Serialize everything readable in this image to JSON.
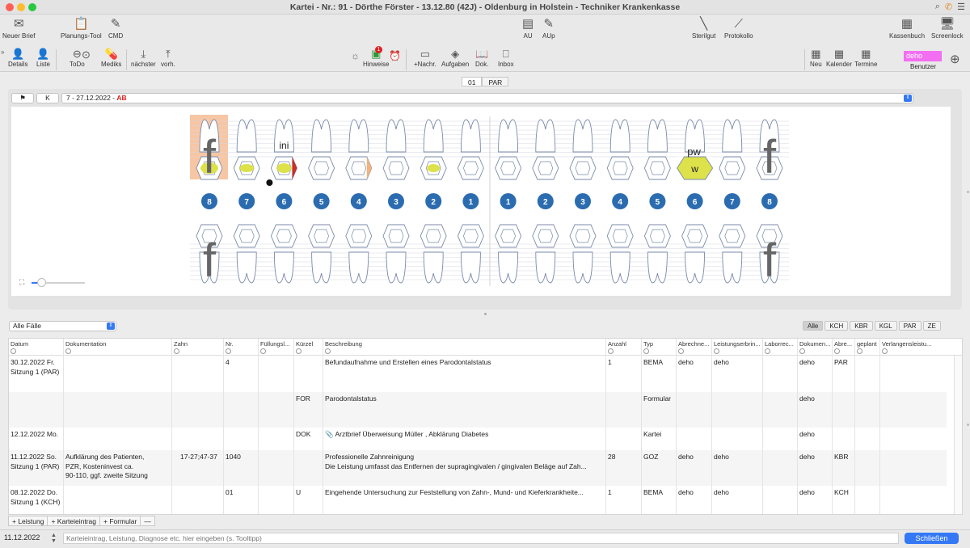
{
  "window": {
    "title": "Kartei - Nr.: 91 - Dörthe Förster - 13.12.80 (42J) - Oldenburg in Holstein - Techniker Krankenkasse"
  },
  "toolbar_top": [
    {
      "label": "Neuer Brief",
      "icon": "letter-icon"
    },
    {
      "label": "Planungs-Tool",
      "icon": "clipboard-icon"
    },
    {
      "label": "CMD",
      "icon": "edit-icon"
    },
    {
      "label": "AU",
      "icon": "document-icon"
    },
    {
      "label": "AUp",
      "icon": "document-edit-icon"
    },
    {
      "label": "Sterilgut",
      "icon": "instrument-icon"
    },
    {
      "label": "Protokollo",
      "icon": "instrument-icon"
    },
    {
      "label": "Kassenbuch",
      "icon": "register-icon"
    },
    {
      "label": "Screenlock",
      "icon": "monitor-lock-icon"
    }
  ],
  "toolbar_second": [
    {
      "label": "Details",
      "icon": "person-icon"
    },
    {
      "label": "Liste",
      "icon": "person-add-icon"
    },
    {
      "label": "ToDo",
      "icon": "arrow-back-icon"
    },
    {
      "label": "Mediks",
      "icon": "pills-icon"
    },
    {
      "label": "nächster",
      "icon": "next-icon"
    },
    {
      "label": "vorh.",
      "icon": "previous-icon"
    },
    {
      "label": "Hinweise",
      "icon": "alert-icon",
      "badge": "1"
    },
    {
      "label": "+Nachr.",
      "icon": "message-icon"
    },
    {
      "label": "Aufgaben",
      "icon": "tasks-icon"
    },
    {
      "label": "Dok.",
      "icon": "book-icon"
    },
    {
      "label": "Inbox",
      "icon": "inbox-icon"
    },
    {
      "label": "Neu",
      "icon": "calendar-add-icon"
    },
    {
      "label": "Kalender",
      "icon": "calendar-icon"
    },
    {
      "label": "Termine",
      "icon": "calendar-icon"
    },
    {
      "label": "Benutzer",
      "icon": "user-icon"
    }
  ],
  "user": {
    "name": "deho"
  },
  "segments": [
    {
      "label": "01",
      "active": true
    },
    {
      "label": "PAR",
      "active": false
    }
  ],
  "chart_header": {
    "flag_label": "",
    "k_label": "K",
    "period": "7 - 27.12.2022 - ",
    "period_code": "AB"
  },
  "teeth": {
    "upper_markers": {
      "f_left": "f",
      "f_right": "f",
      "ini": "ini",
      "pw": "pw",
      "w": "w"
    },
    "lower_markers": {
      "f_left": "f",
      "f_right": "f"
    },
    "numbers": [
      "8",
      "7",
      "6",
      "5",
      "4",
      "3",
      "2",
      "1",
      "1",
      "2",
      "3",
      "4",
      "5",
      "6",
      "7",
      "8"
    ]
  },
  "cases": {
    "selected": "Alle Fälle"
  },
  "filters": [
    {
      "label": "Alle",
      "active": true
    },
    {
      "label": "KCH",
      "active": false
    },
    {
      "label": "KBR",
      "active": false
    },
    {
      "label": "KGL",
      "active": false
    },
    {
      "label": "PAR",
      "active": false
    },
    {
      "label": "ZE",
      "active": false
    }
  ],
  "table": {
    "columns": [
      "Datum",
      "Dokumentation",
      "Zahn",
      "Nr.",
      "Füllungsl...",
      "Kürzel",
      "Beschreibung",
      "Anzahl",
      "Typ",
      "Abrechne...",
      "Leistungserbrin...",
      "Laborrec...",
      "Dokumen...",
      "Abre...",
      "geplant",
      "Verlangensleistu..."
    ],
    "rows": [
      {
        "datum": "30.12.2022 Fr.\nSitzung 1 (PAR)",
        "doku": "",
        "zahn": "",
        "nr": "4",
        "fuell": "",
        "kuerzel": "",
        "beschreibung": "Befundaufnahme und Erstellen eines Parodontalstatus",
        "anzahl": "1",
        "typ": "BEMA",
        "abrechner": "deho",
        "leister": "deho",
        "labor": "",
        "dokumentar": "deho",
        "abre": "PAR",
        "geplant": "",
        "verlangen": ""
      },
      {
        "datum": "",
        "doku": "",
        "zahn": "",
        "nr": "",
        "fuell": "",
        "kuerzel": "FOR",
        "beschreibung": "Parodontalstatus",
        "anzahl": "",
        "typ": "Formular",
        "abrechner": "",
        "leister": "",
        "labor": "",
        "dokumentar": "deho",
        "abre": "",
        "geplant": "",
        "verlangen": ""
      },
      {
        "datum": "12.12.2022 Mo.",
        "doku": "",
        "zahn": "",
        "nr": "",
        "fuell": "",
        "kuerzel": "DOK",
        "beschreibung": "📎 Arztbrief Überweisung Müller , Abklärung Diabetes",
        "anzahl": "",
        "typ": "Kartei",
        "abrechner": "",
        "leister": "",
        "labor": "",
        "dokumentar": "deho",
        "abre": "",
        "geplant": "",
        "verlangen": ""
      },
      {
        "datum": "11.12.2022 So.\nSitzung 1 (PAR)",
        "doku": "Aufklärung des Patienten,\nPZR, Kosteninvest ca.\n90-110, ggf. zweite Sitzung",
        "zahn": "17-27;47-37",
        "nr": "1040",
        "fuell": "",
        "kuerzel": "",
        "beschreibung": "Professionelle Zahnreinigung\nDie Leistung umfasst das Entfernen der supragingivalen / gingivalen Beläge auf Zah...",
        "anzahl": "28",
        "typ": "GOZ",
        "abrechner": "deho",
        "leister": "deho",
        "labor": "",
        "dokumentar": "deho",
        "abre": "KBR",
        "geplant": "",
        "verlangen": ""
      },
      {
        "datum": "08.12.2022 Do.\nSitzung 1 (KCH)",
        "doku": "",
        "zahn": "",
        "nr": "01",
        "fuell": "",
        "kuerzel": "U",
        "beschreibung": "Eingehende Untersuchung zur Feststellung von Zahn-, Mund- und Kieferkrankheite...",
        "anzahl": "1",
        "typ": "BEMA",
        "abrechner": "deho",
        "leister": "deho",
        "labor": "",
        "dokumentar": "deho",
        "abre": "KCH",
        "geplant": "",
        "verlangen": ""
      }
    ]
  },
  "bottom_actions": [
    "+ Leistung",
    "+ Karteieintrag",
    "+ Formular",
    "—"
  ],
  "entry": {
    "date": "11.12.2022",
    "placeholder": "Karteieintrag, Leistung, Diagnose etc. hier eingeben (s. Tooltipp)",
    "close_label": "Schließen"
  },
  "colors": {
    "accent": "#3478f6",
    "user": "#f26ff2",
    "highlight": "#f7c6a4",
    "marker_yellow": "#dde14a"
  }
}
